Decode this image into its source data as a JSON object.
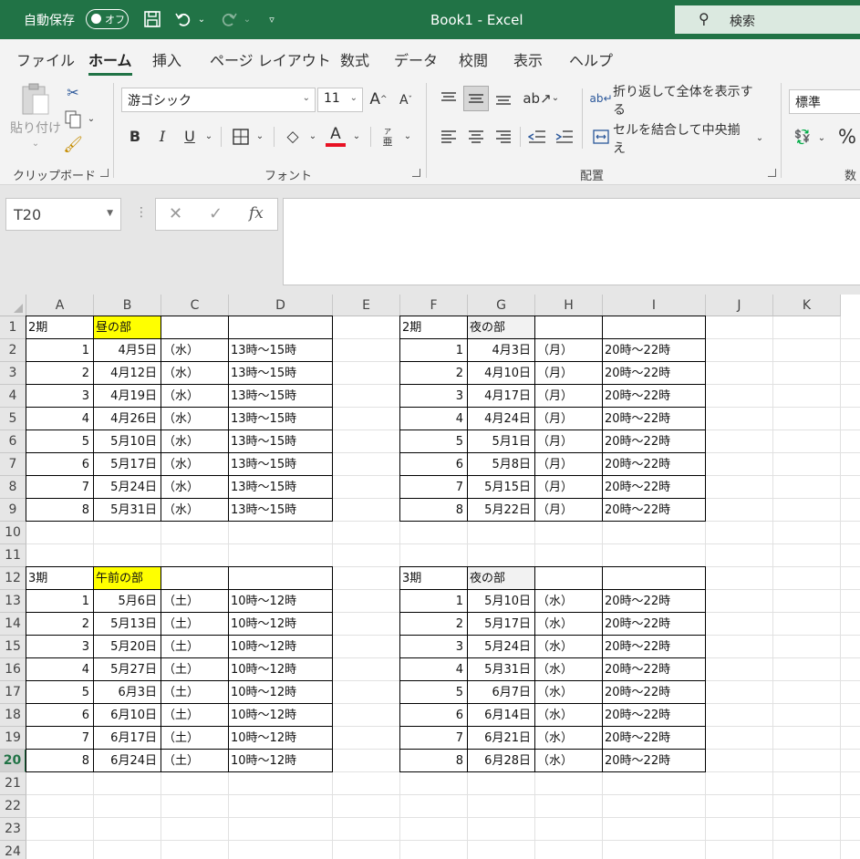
{
  "titlebar": {
    "autosave_label": "自動保存",
    "autosave_state": "オフ",
    "doc_title": "Book1  -  Excel",
    "search_placeholder": "検索",
    "accent_color": "#217346"
  },
  "tabs": [
    "ファイル",
    "ホーム",
    "挿入",
    "ページ レイアウト",
    "数式",
    "データ",
    "校閲",
    "表示",
    "ヘルプ"
  ],
  "active_tab": "ホーム",
  "ribbon": {
    "paste_label": "貼り付け",
    "clipboard_group": "クリップボード",
    "font_name": "游ゴシック",
    "font_size": "11",
    "font_group": "フォント",
    "bold": "B",
    "italic": "I",
    "underline": "U",
    "font_color_glyph": "A",
    "phonetic_glyph": "亜",
    "wrap_text_label": "折り返して全体を表示する",
    "merge_center_label": "セルを結合して中央揃え",
    "alignment_group": "配置",
    "number_format": "標準",
    "number_group_partial": "数",
    "percent_glyph": "%",
    "font_color_swatch": "#e81123"
  },
  "formula_bar": {
    "name_box": "T20",
    "formula_value": ""
  },
  "sheet": {
    "columns": [
      "A",
      "B",
      "C",
      "D",
      "E",
      "F",
      "G",
      "H",
      "I",
      "J",
      "K"
    ],
    "rows": [
      "1",
      "2",
      "3",
      "4",
      "5",
      "6",
      "7",
      "8",
      "9",
      "10",
      "11",
      "12",
      "13",
      "14",
      "15",
      "16",
      "17",
      "18",
      "19",
      "20",
      "21",
      "22",
      "23",
      "24"
    ],
    "selected_row": "20",
    "highlight_color": "#ffff00",
    "tables": [
      {
        "period": "2期",
        "session": "昼の部",
        "header_fill": "yellow",
        "rows": [
          {
            "n": "1",
            "date": "4月5日",
            "day": "（水）",
            "time": "13時～15時"
          },
          {
            "n": "2",
            "date": "4月12日",
            "day": "（水）",
            "time": "13時～15時"
          },
          {
            "n": "3",
            "date": "4月19日",
            "day": "（水）",
            "time": "13時～15時"
          },
          {
            "n": "4",
            "date": "4月26日",
            "day": "（水）",
            "time": "13時～15時"
          },
          {
            "n": "5",
            "date": "5月10日",
            "day": "（水）",
            "time": "13時～15時"
          },
          {
            "n": "6",
            "date": "5月17日",
            "day": "（水）",
            "time": "13時～15時"
          },
          {
            "n": "7",
            "date": "5月24日",
            "day": "（水）",
            "time": "13時～15時"
          },
          {
            "n": "8",
            "date": "5月31日",
            "day": "（水）",
            "time": "13時～15時"
          }
        ]
      },
      {
        "period": "2期",
        "session": "夜の部",
        "header_fill": "gray",
        "rows": [
          {
            "n": "1",
            "date": "4月3日",
            "day": "（月）",
            "time": "20時～22時"
          },
          {
            "n": "2",
            "date": "4月10日",
            "day": "（月）",
            "time": "20時～22時"
          },
          {
            "n": "3",
            "date": "4月17日",
            "day": "（月）",
            "time": "20時～22時"
          },
          {
            "n": "4",
            "date": "4月24日",
            "day": "（月）",
            "time": "20時～22時"
          },
          {
            "n": "5",
            "date": "5月1日",
            "day": "（月）",
            "time": "20時～22時"
          },
          {
            "n": "6",
            "date": "5月8日",
            "day": "（月）",
            "time": "20時～22時"
          },
          {
            "n": "7",
            "date": "5月15日",
            "day": "（月）",
            "time": "20時～22時"
          },
          {
            "n": "8",
            "date": "5月22日",
            "day": "（月）",
            "time": "20時～22時"
          }
        ]
      },
      {
        "period": "3期",
        "session": "午前の部",
        "header_fill": "yellow",
        "rows": [
          {
            "n": "1",
            "date": "5月6日",
            "day": "（土）",
            "time": "10時～12時"
          },
          {
            "n": "2",
            "date": "5月13日",
            "day": "（土）",
            "time": "10時～12時"
          },
          {
            "n": "3",
            "date": "5月20日",
            "day": "（土）",
            "time": "10時～12時"
          },
          {
            "n": "4",
            "date": "5月27日",
            "day": "（土）",
            "time": "10時～12時"
          },
          {
            "n": "5",
            "date": "6月3日",
            "day": "（土）",
            "time": "10時～12時"
          },
          {
            "n": "6",
            "date": "6月10日",
            "day": "（土）",
            "time": "10時～12時"
          },
          {
            "n": "7",
            "date": "6月17日",
            "day": "（土）",
            "time": "10時～12時"
          },
          {
            "n": "8",
            "date": "6月24日",
            "day": "（土）",
            "time": "10時～12時"
          }
        ]
      },
      {
        "period": "3期",
        "session": "夜の部",
        "header_fill": "gray",
        "rows": [
          {
            "n": "1",
            "date": "5月10日",
            "day": "（水）",
            "time": "20時～22時"
          },
          {
            "n": "2",
            "date": "5月17日",
            "day": "（水）",
            "time": "20時～22時"
          },
          {
            "n": "3",
            "date": "5月24日",
            "day": "（水）",
            "time": "20時～22時"
          },
          {
            "n": "4",
            "date": "5月31日",
            "day": "（水）",
            "time": "20時～22時"
          },
          {
            "n": "5",
            "date": "6月7日",
            "day": "（水）",
            "time": "20時～22時"
          },
          {
            "n": "6",
            "date": "6月14日",
            "day": "（水）",
            "time": "20時～22時"
          },
          {
            "n": "7",
            "date": "6月21日",
            "day": "（水）",
            "time": "20時～22時"
          },
          {
            "n": "8",
            "date": "6月28日",
            "day": "（水）",
            "time": "20時～22時"
          }
        ]
      }
    ]
  }
}
